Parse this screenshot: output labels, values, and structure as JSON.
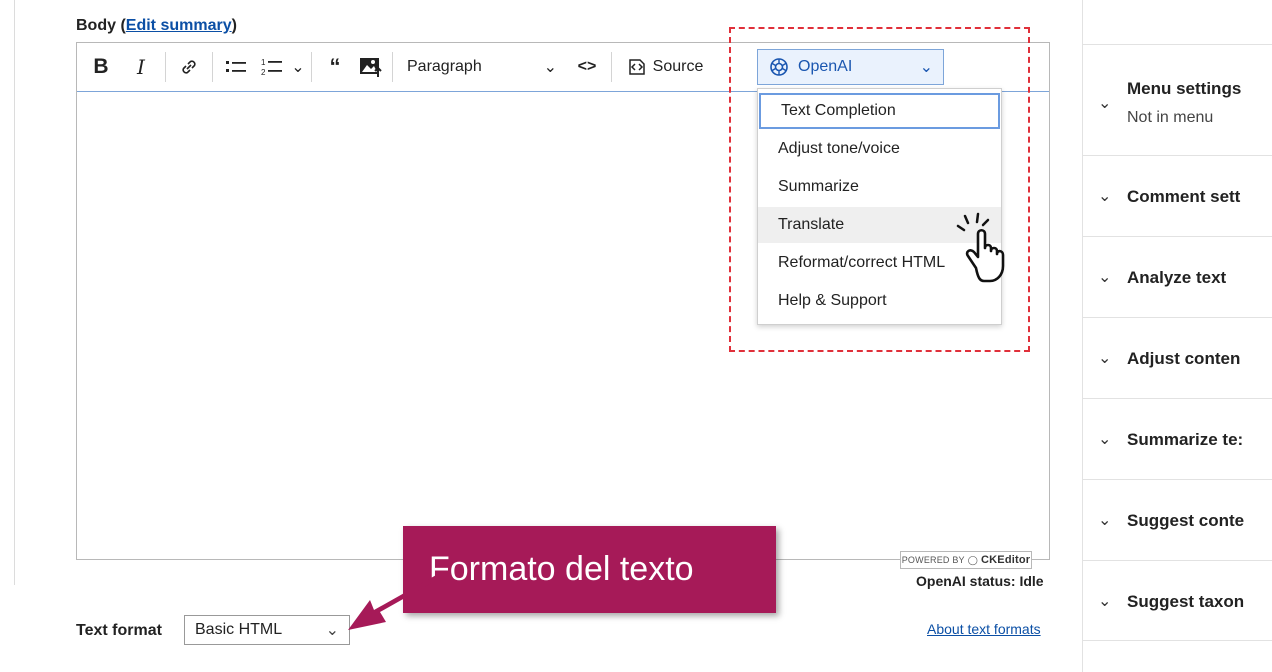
{
  "body_field": {
    "label": "Body",
    "open_paren": "(",
    "edit_summary": "Edit summary",
    "close_paren": ")"
  },
  "toolbar": {
    "bold": "B",
    "italic": "I",
    "link_icon": "link-icon",
    "paragraph": "Paragraph",
    "code": "<>",
    "source": "Source",
    "openai": "OpenAI"
  },
  "openai_menu": {
    "items": [
      "Text Completion",
      "Adjust tone/voice",
      "Summarize",
      "Translate",
      "Reformat/correct HTML",
      "Help & Support"
    ],
    "selected": "Text Completion",
    "hovered": "Translate"
  },
  "editor": {
    "powered_by": "POWERED BY",
    "ckeditor": "CKEditor",
    "status": "OpenAI status: Idle"
  },
  "text_format": {
    "label": "Text format",
    "value": "Basic HTML",
    "about": "About text formats"
  },
  "callout": {
    "text": "Formato del texto"
  },
  "sidebar": {
    "items": [
      {
        "title": "Menu settings",
        "subtitle": "Not in menu"
      },
      {
        "title": "Comment sett"
      },
      {
        "title": "Analyze text"
      },
      {
        "title": "Adjust conten"
      },
      {
        "title": "Summarize te:"
      },
      {
        "title": "Suggest conte"
      },
      {
        "title": "Suggest taxon"
      }
    ]
  },
  "colors": {
    "accent": "#a61a58",
    "dash": "#e0303a",
    "link": "#0b4fa5"
  }
}
